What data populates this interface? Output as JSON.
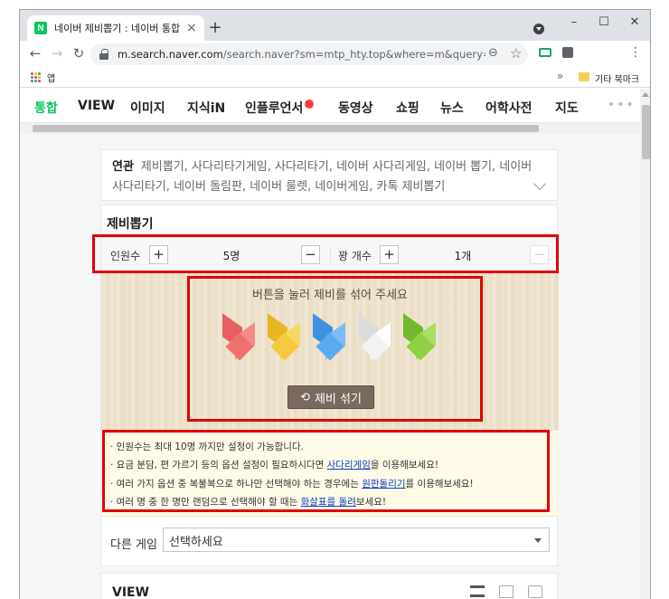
{
  "browser": {
    "tab_title": "네이버 제비뽑기 : 네이버 통합검색",
    "tab_close": "×",
    "new_tab": "+",
    "win_min": "–",
    "win_max": "☐",
    "win_close": "✕",
    "back": "←",
    "forward": "→",
    "reload": "↻",
    "url_host": "m.search.naver.com",
    "url_rest": "/search.naver?sm=mtp_hty.top&where=m&query=네이버...",
    "zoom_icon": "⊖",
    "star_icon": "☆",
    "menu_icon": "⋮",
    "apps_label": "앱",
    "bookmark_more": "»",
    "other_bookmarks": "기타 북마크",
    "favicon_letter": "N"
  },
  "nav": {
    "items": [
      "통합",
      "VIEW",
      "이미지",
      "지식iN",
      "인플루언서",
      "동영상",
      "쇼핑",
      "뉴스",
      "어학사전",
      "지도"
    ],
    "more": "•••"
  },
  "related": {
    "label": "연관",
    "text": "제비뽑기, 사다리타기게임, 사다리타기, 네이버 사다리게임, 네이버 뽑기, 네이버 사다리타기, 네이버 돌림판, 네이버 룰렛, 네이버게임, 카톡 제비뽑기"
  },
  "widget": {
    "title": "제비뽑기",
    "people_label": "인원수",
    "people_value": "5명",
    "lose_label": "꽝 개수",
    "lose_value": "1개",
    "plus": "+",
    "minus": "−",
    "board_text": "버튼을 눌러 제비를 섞어 주세요",
    "shuffle_icon": "⟲",
    "shuffle_label": "제비 섞기",
    "notices": [
      {
        "pre": "· 인원수는 최대 10명 까지만 설정이 가능합니다.",
        "link": "",
        "post": ""
      },
      {
        "pre": "· 요금 분담, 편 가르기 등의 옵션 설정이 필요하시다면 ",
        "link": "사다리게임",
        "post": "을 이용해보세요!"
      },
      {
        "pre": "· 여러 가지 옵션 중 복불복으로 하나만 선택해야 하는 경우에는 ",
        "link": "원판돌리기",
        "post": "를 이용해보세요!"
      },
      {
        "pre": "· 여러 명 중 한 명만 랜덤으로 선택해야 할 때는 ",
        "link": "화살표를 돌려",
        "post": "보세요!"
      }
    ],
    "other_game_label": "다른 게임",
    "select_value": "선택하세요"
  },
  "view_card": {
    "title": "VIEW"
  },
  "colors": {
    "naver_green": "#03c75a",
    "highlight_red": "#e00000",
    "ticket_red": "#f07070",
    "ticket_yellow": "#f5c940",
    "ticket_blue": "#5aaaf0",
    "ticket_white": "#f2f2f2",
    "ticket_green": "#8fd044"
  }
}
